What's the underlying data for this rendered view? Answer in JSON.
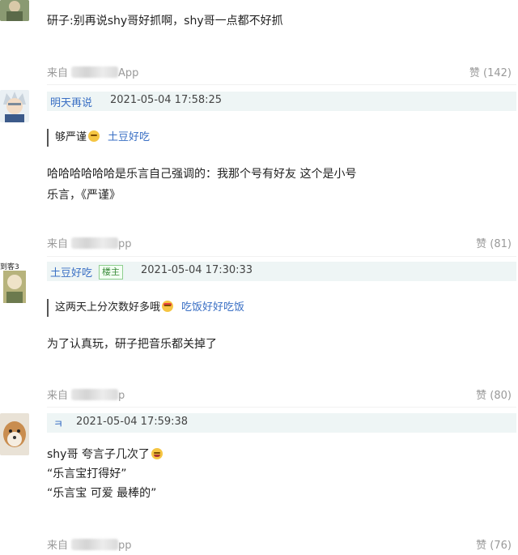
{
  "comments": [
    {
      "reply_text": "研子:别再说shy哥好抓啊，shy哥一点都不好抓",
      "source_prefix": "来自",
      "source_suffix": "App",
      "like_label": "赞 (142)"
    },
    {
      "username": "明天再说",
      "timestamp": "2021-05-04 17:58:25",
      "quote_text": "够严谨",
      "quote_author": "土豆好吃",
      "body_lines": [
        "哈哈哈哈哈哈是乐言自己强调的：我那个号有好友 这个是小号",
        "乐言，《严谨》"
      ],
      "source_prefix": "来自",
      "source_suffix": "pp",
      "like_label": "赞 (81)"
    },
    {
      "avatar_label": "到客3",
      "username": "土豆好吃",
      "badge": "楼主",
      "timestamp": "2021-05-04 17:30:33",
      "quote_text": "这两天上分次数好多哦",
      "quote_author": "吃饭好好吃饭",
      "body_lines": [
        "为了认真玩，研子把音乐都关掉了"
      ],
      "source_prefix": "来自",
      "source_suffix": "p",
      "like_label": "赞 (80)"
    },
    {
      "username": "ㅋ",
      "timestamp": "2021-05-04 17:59:38",
      "body_lines": [
        "shy哥 夸言子几次了",
        "“乐言宝打得好”",
        "“乐言宝 可爱 最棒的”"
      ],
      "source_prefix": "来自",
      "source_suffix": "pp",
      "like_label": "赞 (76)"
    }
  ]
}
